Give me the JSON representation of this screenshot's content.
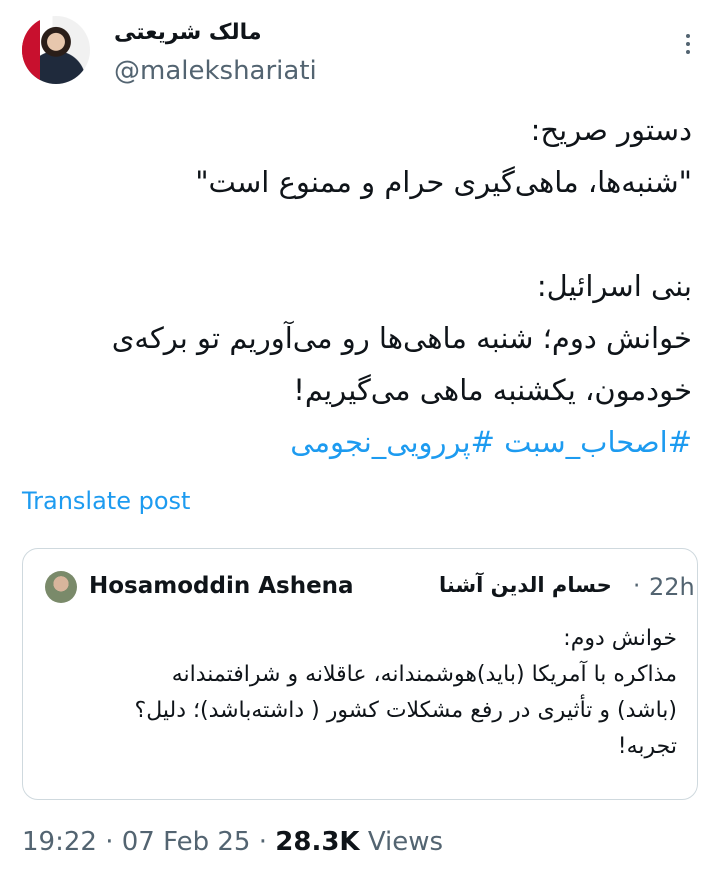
{
  "author": {
    "display_name": "مالک شریعتی",
    "handle": "@malekshariati"
  },
  "tweet": {
    "lines": [
      "دستور صریح:",
      "\"شنبه‌ها، ماهی‌گیری حرام و ممنوع است\"",
      "",
      "بنی اسرائیل:",
      "خوانش دوم؛ شنبه ماهی‌ها رو می‌آوریم تو برکه‌ی",
      "خودمون، یکشنبه ماهی می‌گیریم!"
    ],
    "hashtags": [
      "#اصحاب_سبت",
      "#پررویی_نجومی"
    ],
    "translate_label": "Translate post"
  },
  "quote": {
    "author_name": "Hosamoddin Ashena",
    "author_name_fa": "حسام الدین آشنا",
    "separator": "·",
    "time": "22h",
    "lines": [
      "خوانش دوم:",
      "مذاکره با آمریکا (باید)هوشمندانه، عاقلانه و شرافتمندانه",
      "(باشد) و  تأثیری در رفع مشکلات کشور ( داشته‌باشد)؛ دلیل؟",
      "تجربه!"
    ]
  },
  "meta": {
    "time": "19:22",
    "sep1": "·",
    "date": "07 Feb 25",
    "sep2": "·",
    "views_count": "28.3K",
    "views_label": "Views"
  },
  "colors": {
    "link": "#1d9bf0",
    "secondary_text": "#536471",
    "border": "#cfd9de"
  },
  "icons": [
    "more-options-icon"
  ]
}
